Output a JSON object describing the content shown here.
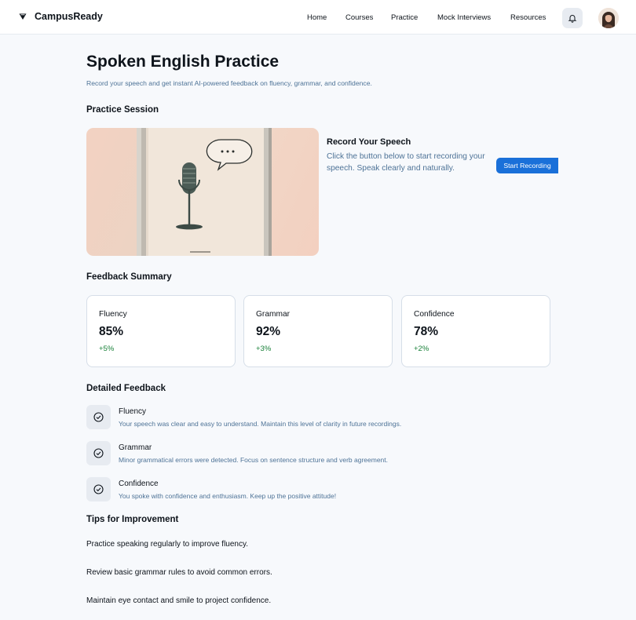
{
  "header": {
    "brand": "CampusReady",
    "nav": [
      "Home",
      "Courses",
      "Practice",
      "Mock Interviews",
      "Resources"
    ],
    "icons": {
      "logo": "triangle-logo-icon",
      "notifications": "bell-icon",
      "profile": "avatar"
    }
  },
  "page": {
    "title": "Spoken English Practice",
    "subtitle": "Record your speech and get instant AI-powered feedback on fluency, grammar, and confidence."
  },
  "practice": {
    "heading": "Practice Session",
    "record_title": "Record Your Speech",
    "record_desc": "Click the button below to start recording your speech. Speak clearly and naturally.",
    "button": "Start Recording"
  },
  "summary": {
    "heading": "Feedback Summary",
    "cards": [
      {
        "label": "Fluency",
        "value": "85%",
        "delta": "+5%"
      },
      {
        "label": "Grammar",
        "value": "92%",
        "delta": "+3%"
      },
      {
        "label": "Confidence",
        "value": "78%",
        "delta": "+2%"
      }
    ],
    "positive_color": "#188038"
  },
  "detailed": {
    "heading": "Detailed Feedback",
    "items": [
      {
        "title": "Fluency",
        "desc": "Your speech was clear and easy to understand. Maintain this level of clarity in future recordings."
      },
      {
        "title": "Grammar",
        "desc": "Minor grammatical errors were detected. Focus on sentence structure and verb agreement."
      },
      {
        "title": "Confidence",
        "desc": "You spoke with confidence and enthusiasm. Keep up the positive attitude!"
      }
    ]
  },
  "tips": {
    "heading": "Tips for Improvement",
    "items": [
      "Practice speaking regularly to improve fluency.",
      "Review basic grammar rules to avoid common errors.",
      "Maintain eye contact and smile to project confidence."
    ]
  },
  "colors": {
    "accent": "#1a70d9",
    "muted_text": "#4e7397",
    "background": "#f7f9fc"
  }
}
